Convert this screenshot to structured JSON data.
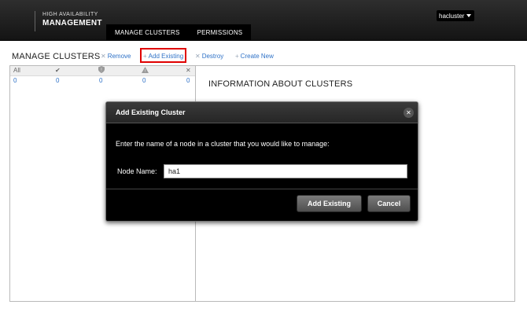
{
  "header": {
    "brand_line1": "HIGH AVAILABILITY",
    "brand_line2": "MANAGEMENT",
    "nav_tabs": [
      {
        "label": "MANAGE CLUSTERS"
      },
      {
        "label": "PERMISSIONS"
      }
    ],
    "user_menu": "hacluster"
  },
  "toolbar": {
    "title": "MANAGE CLUSTERS",
    "remove_label": "Remove",
    "add_existing_label": "Add Existing",
    "destroy_label": "Destroy",
    "create_new_label": "Create New"
  },
  "status_summary": {
    "all_label": "All",
    "counts": [
      "0",
      "0",
      "0",
      "0",
      "0"
    ],
    "icons": [
      "check-icon",
      "shield-icon",
      "warning-icon",
      "x-icon"
    ]
  },
  "info_panel": {
    "title": "INFORMATION ABOUT CLUSTERS"
  },
  "modal": {
    "title": "Add Existing Cluster",
    "prompt": "Enter the name of a node in a cluster that you would like to manage:",
    "node_label": "Node Name:",
    "node_value": "ha1",
    "submit_label": "Add Existing",
    "cancel_label": "Cancel"
  },
  "colors": {
    "link": "#2f72c7",
    "highlight": "#e00000",
    "header_bg": "#1e1e1e",
    "modal_bg": "#000000"
  }
}
